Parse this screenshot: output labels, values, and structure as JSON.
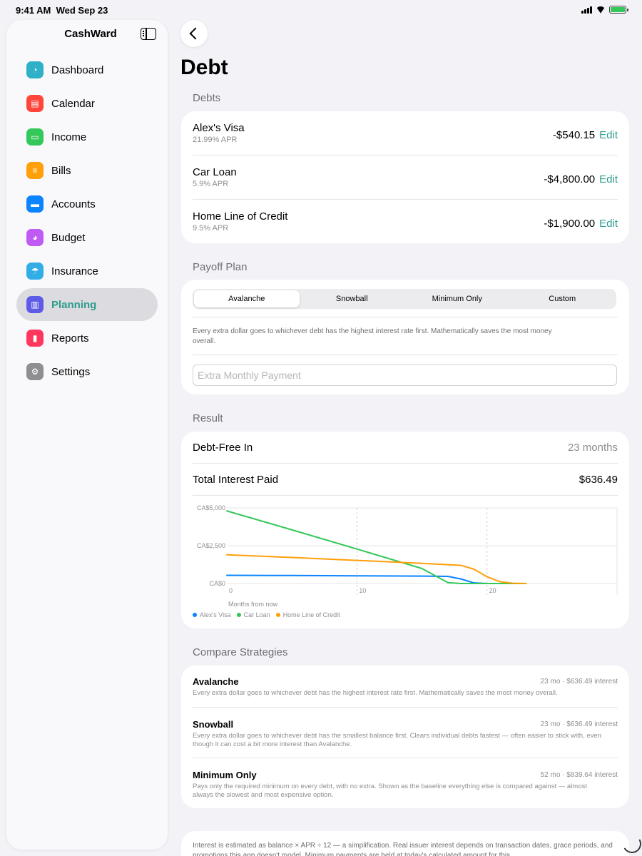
{
  "status": {
    "time": "9:41 AM",
    "date": "Wed Sep 23"
  },
  "sidebar": {
    "title": "CashWard",
    "items": [
      {
        "label": "Dashboard",
        "icon": "gauge-icon",
        "color": "#30b0c7",
        "glyph": "◔"
      },
      {
        "label": "Calendar",
        "icon": "calendar-icon",
        "color": "#ff453a",
        "glyph": "▤"
      },
      {
        "label": "Income",
        "icon": "banknote-icon",
        "color": "#34c759",
        "glyph": "▭"
      },
      {
        "label": "Bills",
        "icon": "document-icon",
        "color": "#ff9f0a",
        "glyph": "≡"
      },
      {
        "label": "Accounts",
        "icon": "card-icon",
        "color": "#0a84ff",
        "glyph": "▬"
      },
      {
        "label": "Budget",
        "icon": "pie-icon",
        "color": "#bf5af2",
        "glyph": "◕"
      },
      {
        "label": "Insurance",
        "icon": "umbrella-icon",
        "color": "#32ade6",
        "glyph": "☂"
      },
      {
        "label": "Planning",
        "icon": "map-icon",
        "color": "#5e5ce6",
        "glyph": "▥"
      },
      {
        "label": "Reports",
        "icon": "chart-icon",
        "color": "#ff375f",
        "glyph": "▮"
      },
      {
        "label": "Settings",
        "icon": "gear-icon",
        "color": "#8e8e93",
        "glyph": "⚙"
      }
    ],
    "active": "Planning"
  },
  "page": {
    "title": "Debt"
  },
  "debts": {
    "header": "Debts",
    "items": [
      {
        "name": "Alex's Visa",
        "apr": "21.99% APR",
        "balance": "-$540.15",
        "edit": "Edit"
      },
      {
        "name": "Car Loan",
        "apr": "5.9% APR",
        "balance": "-$4,800.00",
        "edit": "Edit"
      },
      {
        "name": "Home Line of Credit",
        "apr": "9.5% APR",
        "balance": "-$1,900.00",
        "edit": "Edit"
      }
    ]
  },
  "payoff": {
    "header": "Payoff Plan",
    "segments": [
      "Avalanche",
      "Snowball",
      "Minimum Only",
      "Custom"
    ],
    "selected": "Avalanche",
    "description": "Every extra dollar goes to whichever debt has the highest interest rate first. Mathematically saves the most money overall.",
    "extra_payment_placeholder": "Extra Monthly Payment"
  },
  "result": {
    "header": "Result",
    "debt_free_label": "Debt-Free In",
    "debt_free_value": "23 months",
    "interest_label": "Total Interest Paid",
    "interest_value": "$636.49"
  },
  "chart_data": {
    "type": "line",
    "xlabel": "Months from now",
    "ylabel": "",
    "x_ticks": [
      "0",
      "10",
      "20"
    ],
    "y_ticks": [
      "CA$0",
      "CA$2,500",
      "CA$5,000"
    ],
    "xlim": [
      0,
      30
    ],
    "ylim": [
      0,
      5000
    ],
    "grid": true,
    "legend_placement": "bottom-left",
    "series": [
      {
        "name": "Alex's Visa",
        "color": "#0a84ff",
        "points": [
          [
            0,
            540
          ],
          [
            5,
            530
          ],
          [
            10,
            510
          ],
          [
            15,
            490
          ],
          [
            17,
            470
          ],
          [
            18,
            300
          ],
          [
            19,
            40
          ],
          [
            20,
            0
          ],
          [
            23,
            0
          ]
        ]
      },
      {
        "name": "Car Loan",
        "color": "#34c759",
        "points": [
          [
            0,
            4800
          ],
          [
            5,
            3550
          ],
          [
            10,
            2280
          ],
          [
            15,
            990
          ],
          [
            17,
            60
          ],
          [
            18,
            0
          ],
          [
            23,
            0
          ]
        ]
      },
      {
        "name": "Home Line of Credit",
        "color": "#ff9f0a",
        "points": [
          [
            0,
            1900
          ],
          [
            5,
            1720
          ],
          [
            10,
            1530
          ],
          [
            15,
            1330
          ],
          [
            18,
            1200
          ],
          [
            19,
            950
          ],
          [
            20,
            450
          ],
          [
            21,
            120
          ],
          [
            22,
            20
          ],
          [
            23,
            0
          ]
        ]
      }
    ]
  },
  "compare": {
    "header": "Compare Strategies",
    "items": [
      {
        "name": "Avalanche",
        "meta": "23 mo · $636.49 interest",
        "desc": "Every extra dollar goes to whichever debt has the highest interest rate first. Mathematically saves the most money overall."
      },
      {
        "name": "Snowball",
        "meta": "23 mo · $636.49 interest",
        "desc": "Every extra dollar goes to whichever debt has the smallest balance first. Clears individual debts fastest — often easier to stick with, even though it can cost a bit more interest than Avalanche."
      },
      {
        "name": "Minimum Only",
        "meta": "52 mo · $839.64 interest",
        "desc": "Pays only the required minimum on every debt, with no extra. Shown as the baseline everything else is compared against — almost always the slowest and most expensive option."
      }
    ]
  },
  "note": "Interest is estimated as balance × APR ÷ 12 — a simplification. Real issuer interest depends on transaction dates, grace periods, and promotions this app doesn't model. Minimum payments are held at today's calculated amount for this"
}
